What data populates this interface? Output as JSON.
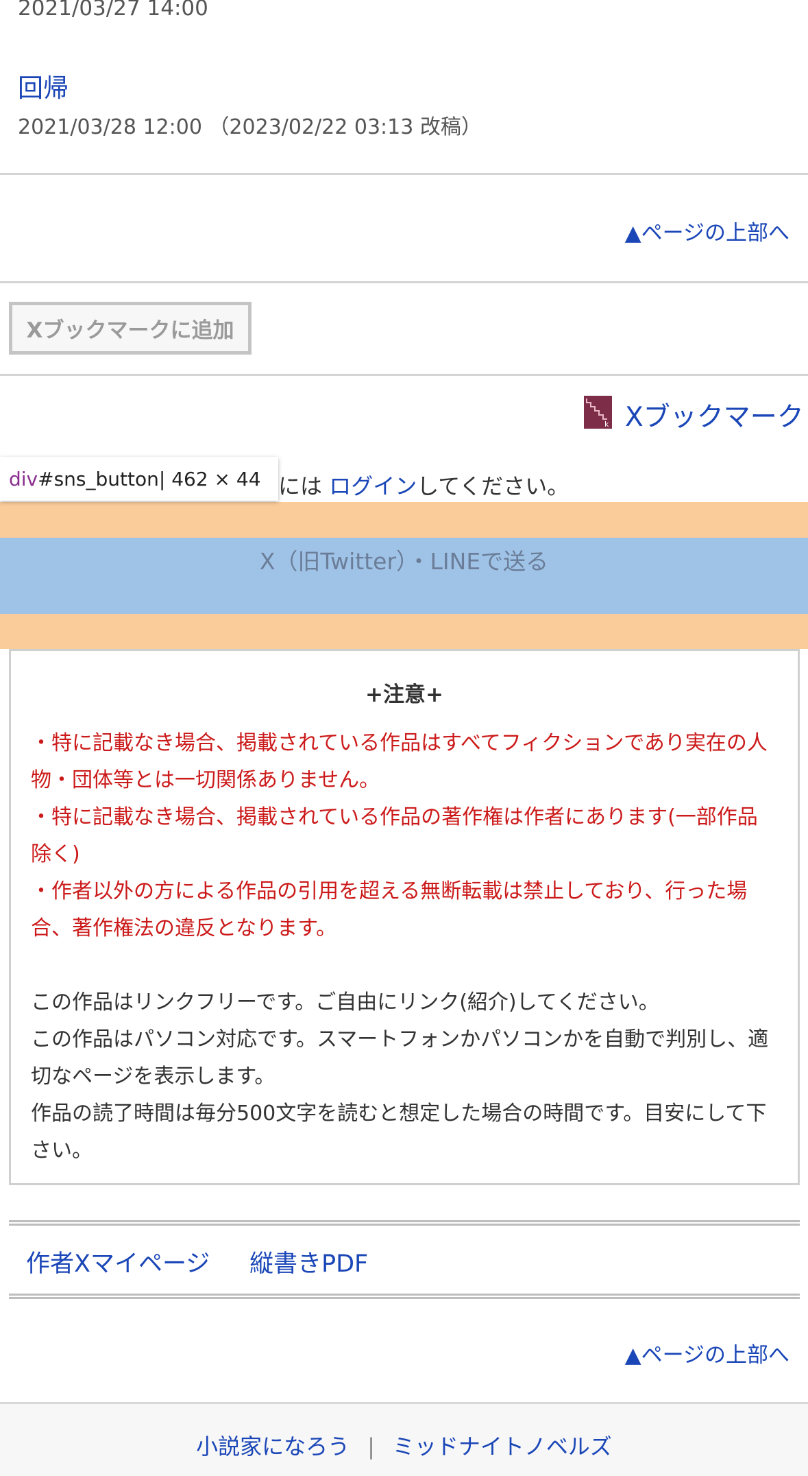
{
  "episodes": {
    "prev_date": "2021/03/27 14:00",
    "title": "回帰",
    "date": "2021/03/28 12:00 （2023/02/22 03:13 改稿）"
  },
  "nav": {
    "page_top": "▲ページの上部へ",
    "page_top_2": "▲ページの上部へ"
  },
  "bookmark": {
    "add_button": "Xブックマークに追加",
    "link_label": "Xブックマーク",
    "icon_letters": "b k"
  },
  "login": {
    "prefix": "には",
    "link": "ログイン",
    "suffix": "してください。"
  },
  "devtools": {
    "tag": "div",
    "selector": "#sns_button",
    "size": " | 462 × 44"
  },
  "sns": {
    "label": "X（旧Twitter）・LINEで送る"
  },
  "notice": {
    "title": "+注意+",
    "red_lines": [
      "・特に記載なき場合、掲載されている作品はすべてフィクションであり実在の人物・団体等とは一切関係ありません。",
      "・特に記載なき場合、掲載されている作品の著作権は作者にあります(一部作品除く)",
      "・作者以外の方による作品の引用を超える無断転載は禁止しており、行った場合、著作権法の違反となります。"
    ],
    "body_lines": [
      "この作品はリンクフリーです。ご自由にリンク(紹介)してください。",
      "この作品はパソコン対応です。スマートフォンかパソコンかを自動で判別し、適切なページを表示します。",
      "作品の読了時間は毎分500文字を読むと想定した場合の時間です。目安にして下さい。"
    ]
  },
  "footer_links": {
    "author_page": "作者Xマイページ",
    "pdf": "縦書きPDF"
  },
  "site_footer": {
    "link1": "小説家になろう",
    "separator": "|",
    "link2": "ミッドナイトノベルズ"
  },
  "colors": {
    "link": "#1a46b7",
    "notice_red": "#cc1a1a",
    "devtools_margin": "#f9cc99",
    "devtools_content": "#9fc3e7",
    "bookmark_icon": "#7d2d48"
  }
}
